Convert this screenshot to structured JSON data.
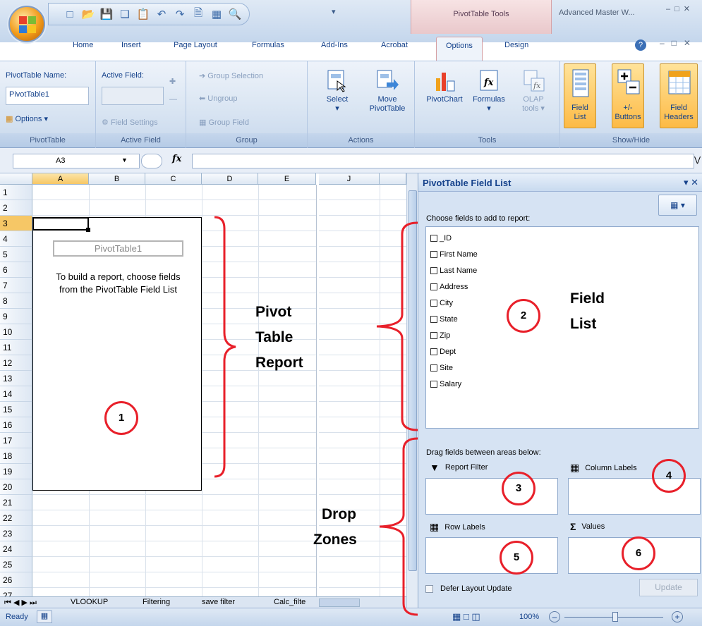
{
  "app": {
    "window_title": "Advanced Master W...",
    "context_tab": "PivotTable Tools"
  },
  "tabs": [
    "Home",
    "Insert",
    "Page Layout",
    "Formulas",
    "Add-Ins",
    "Acrobat",
    "Options",
    "Design"
  ],
  "ribbon": {
    "pivottable": {
      "name_label": "PivotTable Name:",
      "name_value": "PivotTable1",
      "options_label": "Options",
      "group_name": "PivotTable"
    },
    "active_field": {
      "label": "Active Field:",
      "settings_label": "Field Settings",
      "group_name": "Active Field"
    },
    "group": {
      "group_selection": "Group Selection",
      "ungroup": "Ungroup",
      "group_field": "Group Field",
      "group_name": "Group"
    },
    "actions": {
      "select": "Select",
      "move_line1": "Move",
      "move_line2": "PivotTable",
      "group_name": "Actions"
    },
    "tools": {
      "pivotchart": "PivotChart",
      "formulas": "Formulas",
      "olap_line1": "OLAP",
      "olap_line2": "tools",
      "group_name": "Tools"
    },
    "show_hide": {
      "field_list_line1": "Field",
      "field_list_line2": "List",
      "buttons_line1": "+/-",
      "buttons_line2": "Buttons",
      "headers_line1": "Field",
      "headers_line2": "Headers",
      "group_name": "Show/Hide"
    }
  },
  "formula_bar": {
    "name_box": "A3",
    "fx": "fx"
  },
  "grid": {
    "columns": [
      "A",
      "B",
      "C",
      "D",
      "E",
      "J"
    ],
    "rows": [
      "1",
      "2",
      "3",
      "4",
      "5",
      "6",
      "7",
      "8",
      "9",
      "10",
      "11",
      "12",
      "13",
      "14",
      "15",
      "16",
      "17",
      "18",
      "19",
      "20",
      "21",
      "22",
      "23",
      "24",
      "25",
      "26",
      "27"
    ],
    "pivot_name": "PivotTable1",
    "pivot_msg_line1": "To build a report, choose fields",
    "pivot_msg_line2": "from the PivotTable Field List"
  },
  "sheet_tabs": [
    "VLOOKUP",
    "Filtering",
    "save filter",
    "Calc_filte"
  ],
  "status": {
    "ready": "Ready",
    "zoom": "100%"
  },
  "field_list": {
    "title": "PivotTable Field List",
    "choose_label": "Choose fields to add to report:",
    "fields": [
      "_ID",
      "First Name",
      "Last Name",
      "Address",
      "City",
      "State",
      "Zip",
      "Dept",
      "Site",
      "Salary"
    ],
    "drag_label": "Drag fields between areas below:",
    "report_filter": "Report Filter",
    "column_labels": "Column Labels",
    "row_labels": "Row Labels",
    "values": "Values",
    "defer_label": "Defer Layout Update",
    "update_label": "Update"
  },
  "annotations": {
    "pivot_line1": "Pivot",
    "pivot_line2": "Table",
    "pivot_line3": "Report",
    "field_line1": "Field",
    "field_line2": "List",
    "drop_line1": "Drop",
    "drop_line2": "Zones",
    "n1": "1",
    "n2": "2",
    "n3": "3",
    "n4": "4",
    "n5": "5",
    "n6": "6"
  },
  "colors": {
    "accent_red": "#e8202a",
    "ribbon_blue": "#15428b",
    "toggle_orange": "#fdba45"
  }
}
